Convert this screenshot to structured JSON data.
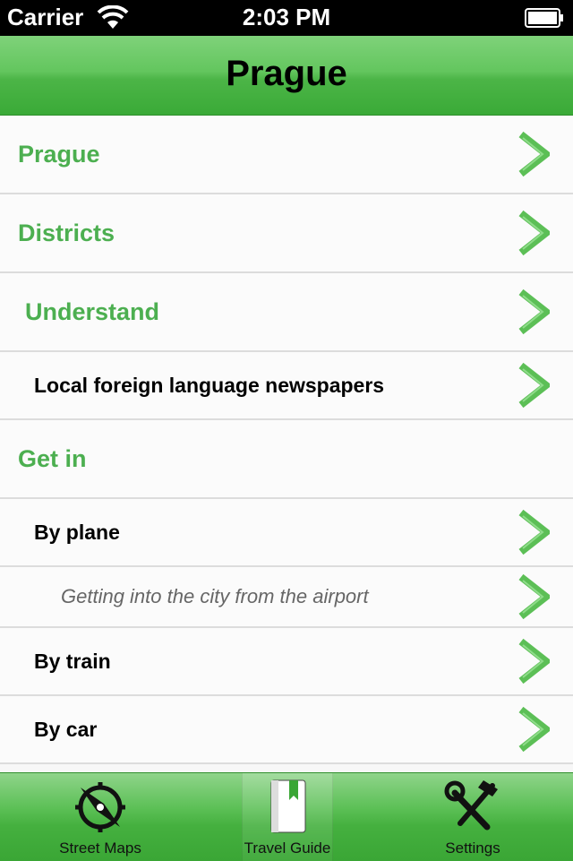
{
  "status_bar": {
    "carrier": "Carrier",
    "time": "2:03 PM"
  },
  "nav": {
    "title": "Prague"
  },
  "rows": [
    {
      "label": "Prague",
      "level": "h1",
      "chevron": true
    },
    {
      "label": "Districts",
      "level": "h1",
      "chevron": true
    },
    {
      "label": "Understand",
      "level": "h1",
      "chevron": true
    },
    {
      "label": "Local foreign language newspapers",
      "level": "h2",
      "chevron": true
    },
    {
      "label": "Get in",
      "level": "h1",
      "chevron": false
    },
    {
      "label": "By plane",
      "level": "h2",
      "chevron": true
    },
    {
      "label": "Getting into the city from the airport",
      "level": "h3",
      "chevron": true
    },
    {
      "label": "By train",
      "level": "h2",
      "chevron": true
    },
    {
      "label": "By car",
      "level": "h2",
      "chevron": true
    }
  ],
  "tabs": [
    {
      "label": "Street Maps",
      "icon": "compass-icon",
      "selected": false
    },
    {
      "label": "Travel Guide",
      "icon": "book-icon",
      "selected": true
    },
    {
      "label": "Settings",
      "icon": "tools-icon",
      "selected": false
    }
  ],
  "colors": {
    "accent": "#4caf50",
    "nav_green": "#4cb547",
    "chevron": "#5cbf56"
  }
}
